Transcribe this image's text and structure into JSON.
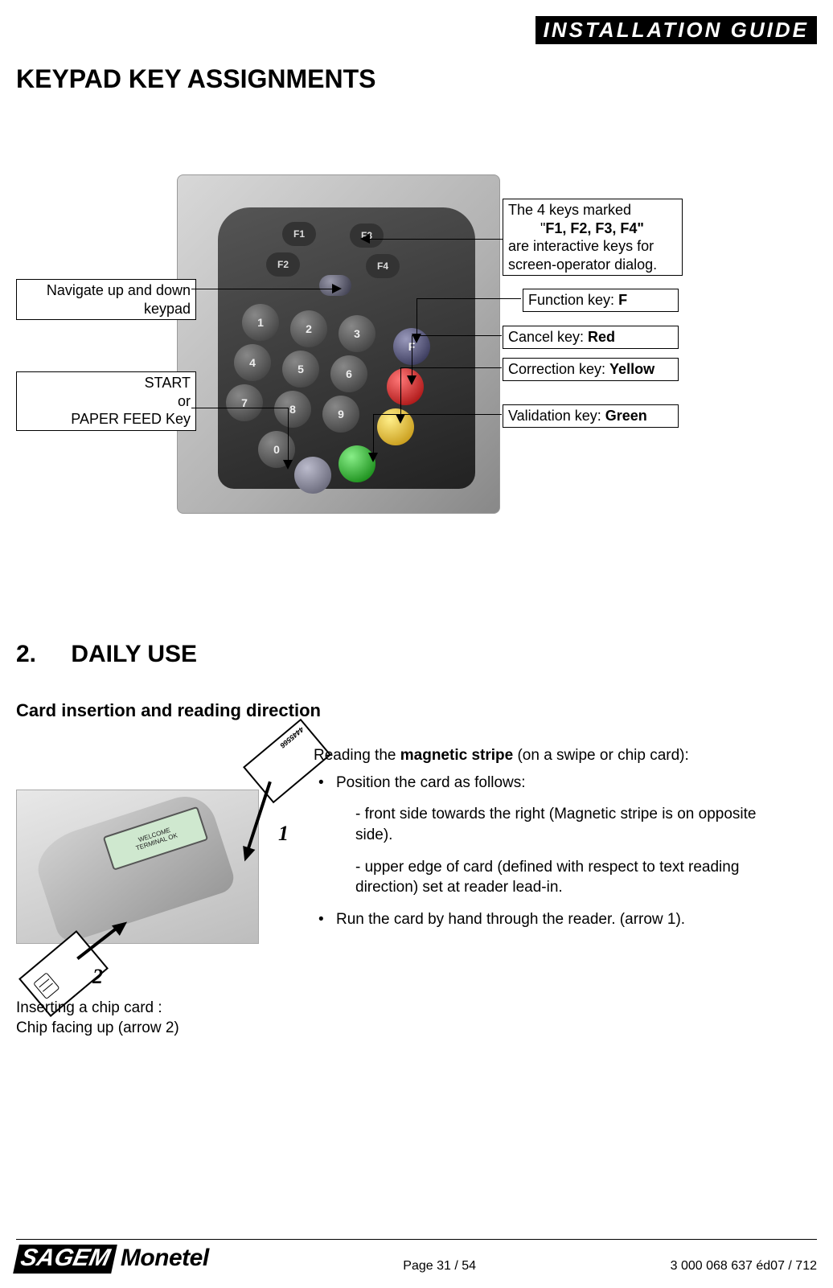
{
  "header": {
    "title": "INSTALLATION GUIDE"
  },
  "section1": {
    "title": "KEYPAD KEY ASSIGNMENTS"
  },
  "callouts": {
    "left1_l1": "Navigate up and down",
    "left1_l2": "keypad",
    "left2_l1": "START",
    "left2_l2": "or",
    "left2_l3": "PAPER FEED Key",
    "r_box_l1": "The 4 keys marked",
    "r_box_l2_pre": "\"",
    "r_box_l2_bold": "F1, F2, F3, F4\"",
    "r_box_l3": "are interactive keys for",
    "r_box_l4": "screen-operator dialog.",
    "r_fn_pre": "Function key: ",
    "r_fn_bold": "F",
    "r_cancel_pre": "Cancel key: ",
    "r_cancel_bold": "Red",
    "r_corr_pre": "Correction key: ",
    "r_corr_bold": "Yellow",
    "r_valid_pre": "Validation key: ",
    "r_valid_bold": "Green"
  },
  "keypad": {
    "fn": {
      "f1": "F1",
      "f2": "F2",
      "f3": "F3",
      "f4": "F4"
    },
    "f_side": "F"
  },
  "section2": {
    "num": "2.",
    "title": "DAILY USE",
    "subhead": "Card insertion and reading direction"
  },
  "card_text": {
    "intro_pre": "Reading the ",
    "intro_bold": "magnetic stripe",
    "intro_post": " (on a swipe or chip card):",
    "b1": "Position the card as follows:",
    "p1": "- front side towards the right (Magnetic stripe is on opposite side).",
    "p2": "- upper edge of card (defined with respect to text reading direction) set at reader lead-in.",
    "b2": "Run the card by hand through the reader. (arrow 1).",
    "marker1": "1",
    "marker2": "2",
    "stripe_num": "4445566",
    "screen_l1": "WELCOME",
    "screen_l2": "TERMINAL OK",
    "chip_caption_l1_pre": "Inserting a ",
    "chip_caption_l1_bold": "chip card",
    "chip_caption_l1_post": " :",
    "chip_caption_l2": "Chip facing up (arrow 2)"
  },
  "footer": {
    "logo1": "SAGEM",
    "logo2": "Monetel",
    "page": "Page 31 / 54",
    "doc": "3 000 068 637 éd07 / 712"
  }
}
